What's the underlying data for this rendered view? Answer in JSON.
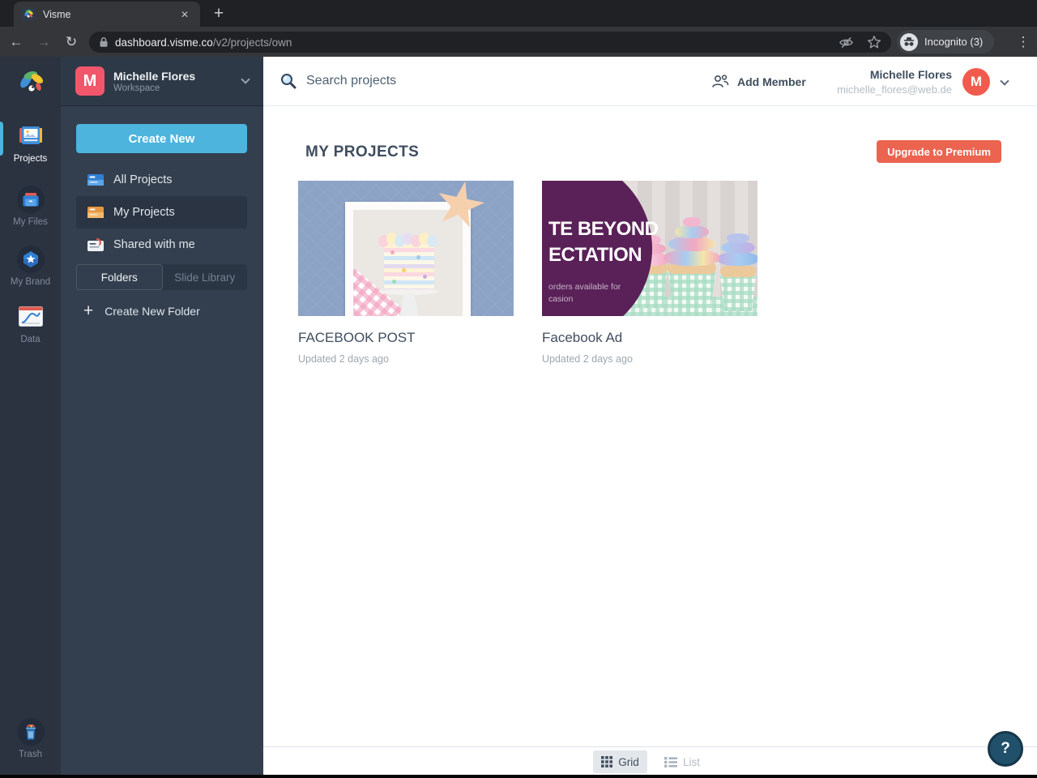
{
  "browser": {
    "tab_title": "Visme",
    "url_host": "dashboard.visme.co",
    "url_path": "/v2/projects/own",
    "incognito_label": "Incognito (3)"
  },
  "icons": {
    "back": "←",
    "forward": "→",
    "reload": "↻",
    "close": "✕",
    "new_tab": "+",
    "menu": "⋮",
    "plus": "+"
  },
  "rail": {
    "items": [
      {
        "label": "Projects"
      },
      {
        "label": "My Files"
      },
      {
        "label": "My Brand"
      },
      {
        "label": "Data"
      }
    ],
    "trash_label": "Trash"
  },
  "workspace": {
    "avatar_letter": "M",
    "name": "Michelle Flores",
    "type": "Workspace"
  },
  "sidebar": {
    "create_new_label": "Create New",
    "items": [
      {
        "label": "All Projects"
      },
      {
        "label": "My Projects"
      },
      {
        "label": "Shared with me"
      }
    ],
    "tabs": [
      {
        "label": "Folders"
      },
      {
        "label": "Slide Library"
      }
    ],
    "create_folder_label": "Create New Folder"
  },
  "header": {
    "search_placeholder": "Search projects",
    "add_member_label": "Add Member",
    "user_name": "Michelle Flores",
    "user_email": "michelle_flores@web.de",
    "avatar_letter": "M"
  },
  "main": {
    "title": "MY PROJECTS",
    "upgrade_label": "Upgrade to Premium",
    "projects": [
      {
        "title": "FACEBOOK POST",
        "updated": "Updated 2 days ago"
      },
      {
        "title": "Facebook Ad",
        "updated": "Updated 2 days ago",
        "overlay": {
          "line1": "TE BEYOND",
          "line2": "ECTATION",
          "sub1": "orders available for",
          "sub2": "casion"
        }
      }
    ]
  },
  "footer": {
    "grid_label": "Grid",
    "list_label": "List",
    "help_label": "?"
  },
  "colors": {
    "accent_blue": "#4db4dd",
    "upgrade_red": "#ea6450",
    "workspace_avatar": "#f2566b",
    "user_avatar": "#f15b4e",
    "rail_bg": "#2b3240",
    "sidebar_bg": "#333f4e",
    "help_bg": "#20506a"
  }
}
